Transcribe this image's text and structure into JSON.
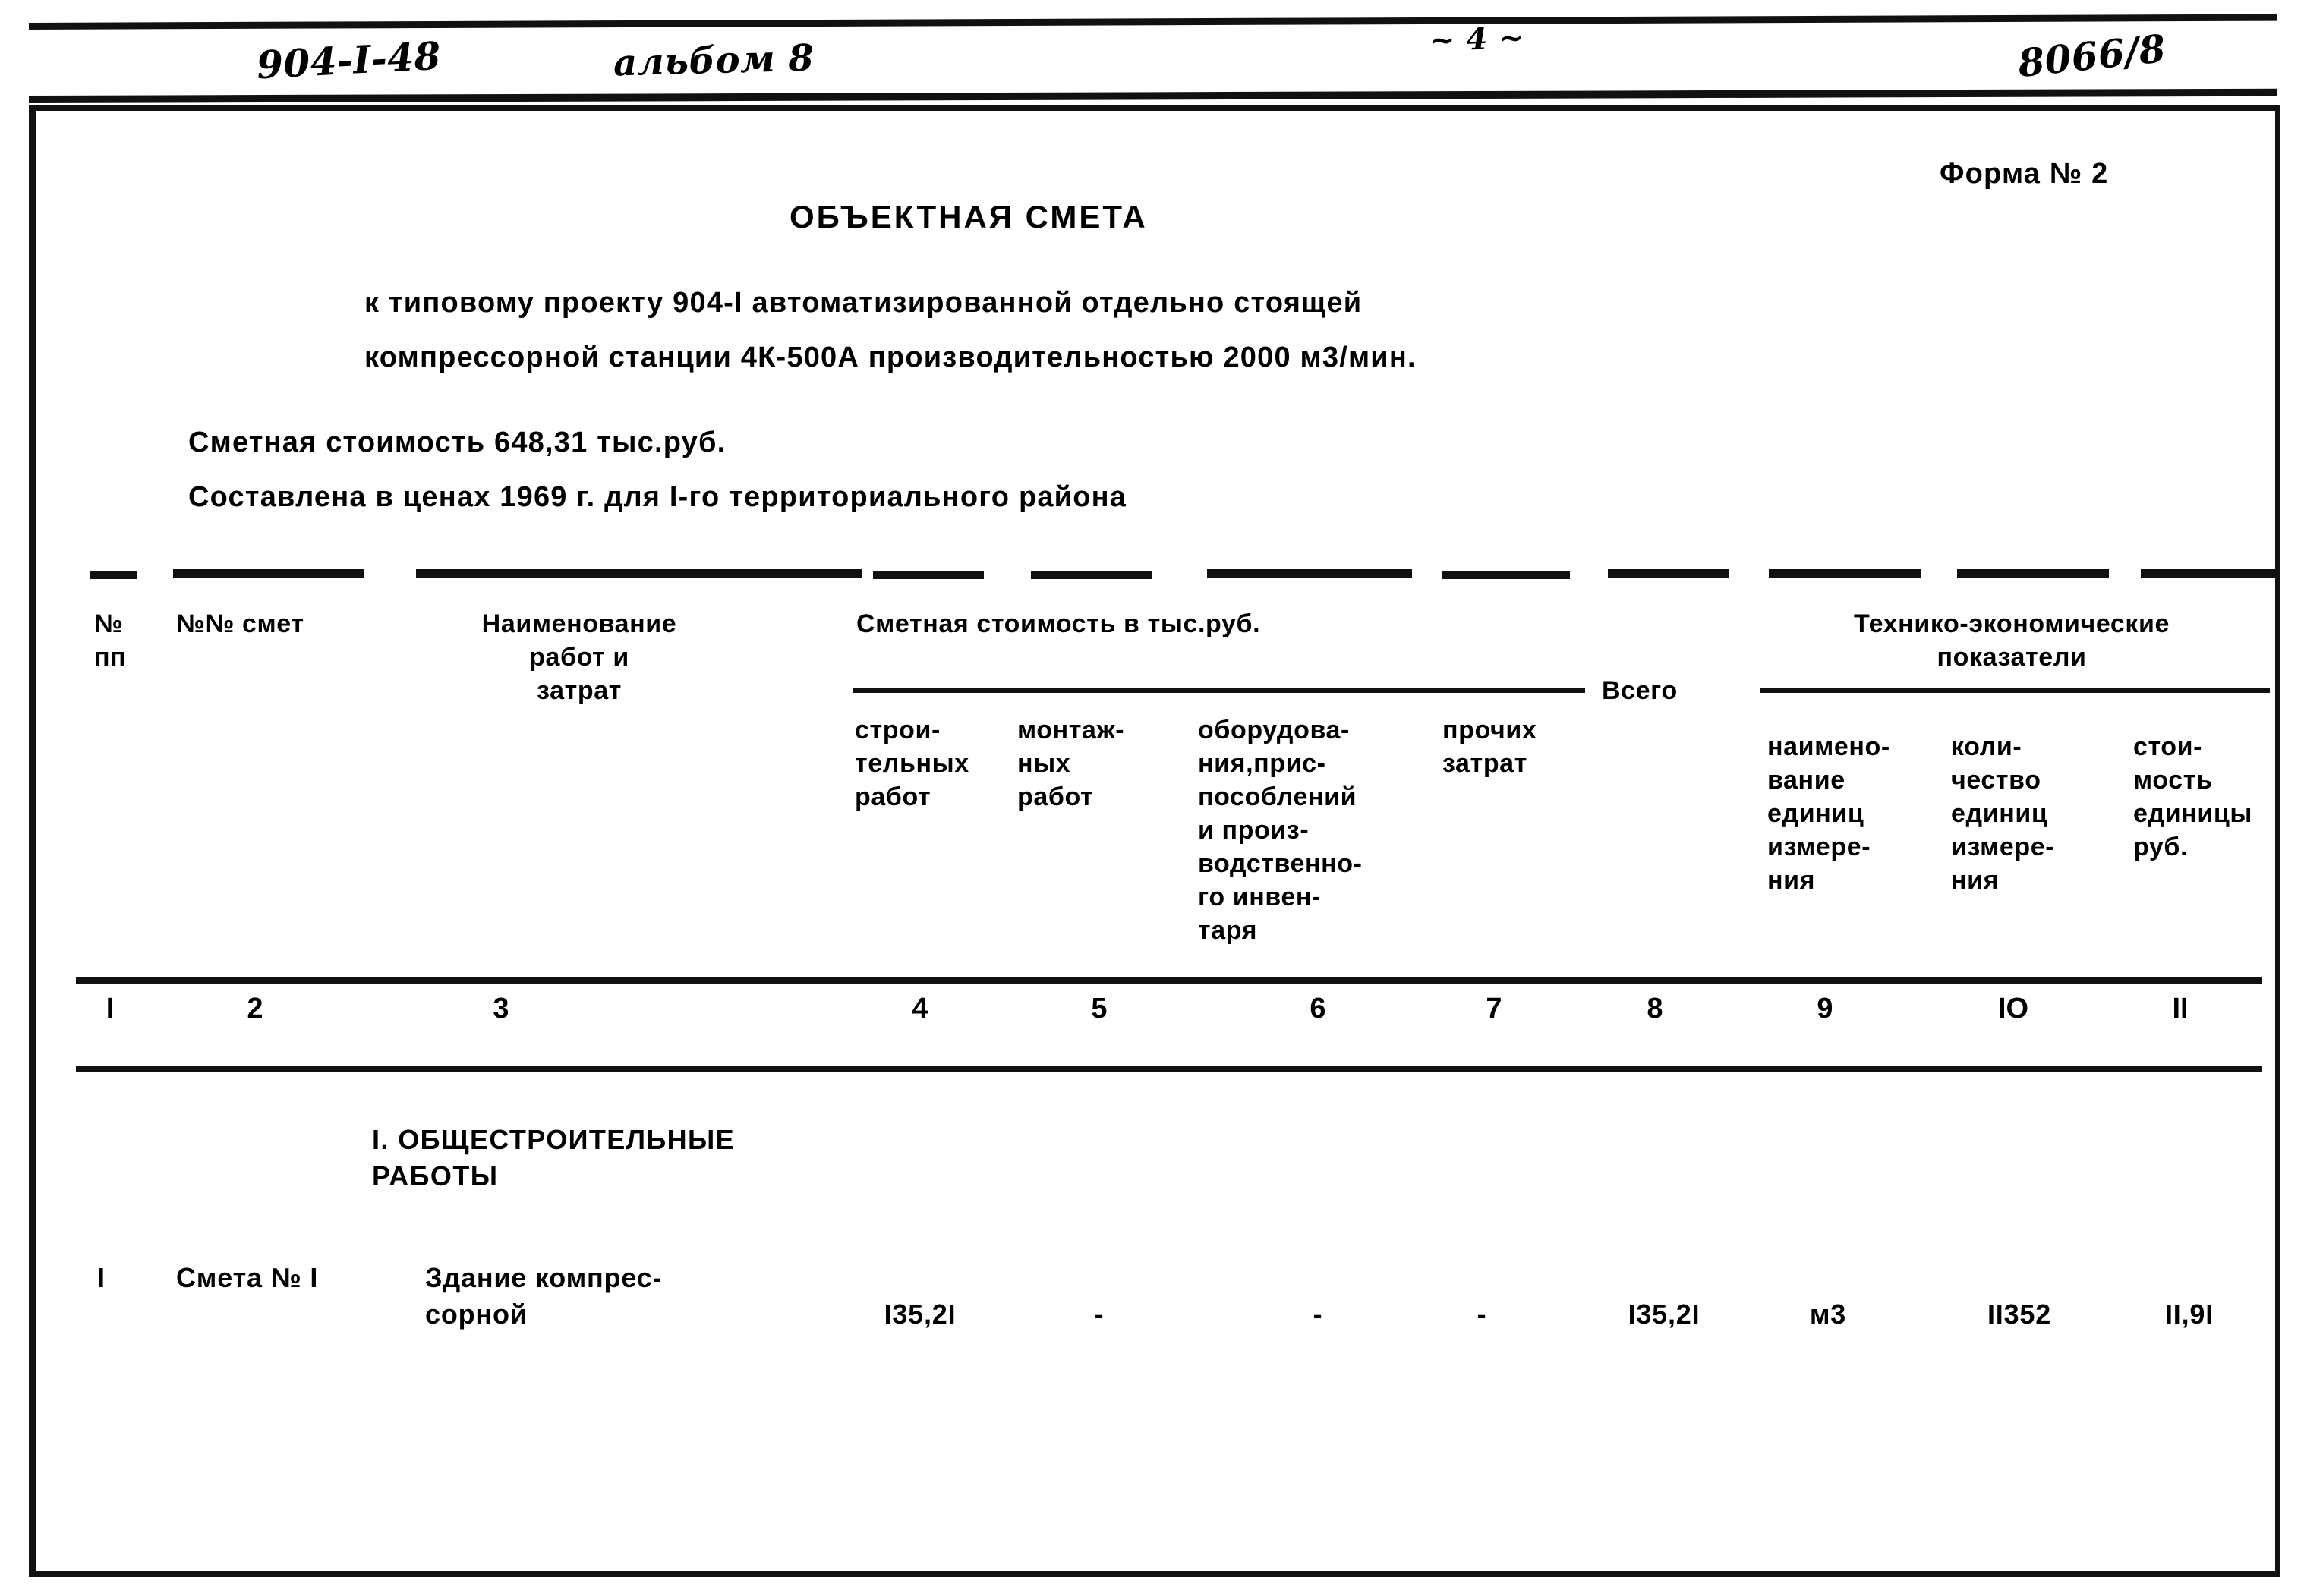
{
  "handwritten_header": {
    "project_code": "904-I-48",
    "album": "альбом 8",
    "page_mark": "~ 4 ~",
    "doc_number": "8066/8"
  },
  "form_label": "Форма № 2",
  "title": "ОБЪЕКТНАЯ СМЕТА",
  "subtitle_line1": "к типовому проекту 904-I автоматизированной отдельно стоящей",
  "subtitle_line2": "компрессорной станции 4К-500А производительностью 2000 м3/мин.",
  "cost_line1": "Сметная стоимость 648,31 тыс.руб.",
  "cost_line2": "Составлена в ценах 1969 г. для I-го территориального района",
  "table": {
    "header": {
      "col1": "№\nпп",
      "col2": "№№ смет",
      "col3": "Наименование\nработ и\nзатрат",
      "group_cost": "Сметная стоимость в тыс.руб.",
      "col4": "строи-\nтельных\nработ",
      "col5": "монтаж-\nных\nработ",
      "col6": "оборудова-\nния,прис-\nпособлений\nи произ-\nводственно-\nго инвен-\nтаря",
      "col7": "прочих\nзатрат",
      "col8": "Всего",
      "group_tech": "Технико-экономические\nпоказатели",
      "col9": "наимено-\nвание\nединиц\nизмере-\nния",
      "col10": "коли-\nчество\nединиц\nизмере-\nния",
      "col11": "стои-\nмость\nединицы\nруб."
    },
    "column_numbers": [
      "I",
      "2",
      "3",
      "4",
      "5",
      "6",
      "7",
      "8",
      "9",
      "IO",
      "II"
    ],
    "sections": [
      {
        "heading": "I. ОБЩЕСТРОИТЕЛЬНЫЕ\n     РАБОТЫ",
        "rows": [
          {
            "no": "I",
            "estimate_no": "Смета № I",
            "name": "Здание компрес-\nсорной",
            "construction": "I35,2I",
            "installation": "-",
            "equipment": "-",
            "other": "-",
            "total": "I35,2I",
            "unit_name": "м3",
            "unit_qty": "II352",
            "unit_cost": "II,9I"
          }
        ]
      }
    ]
  }
}
